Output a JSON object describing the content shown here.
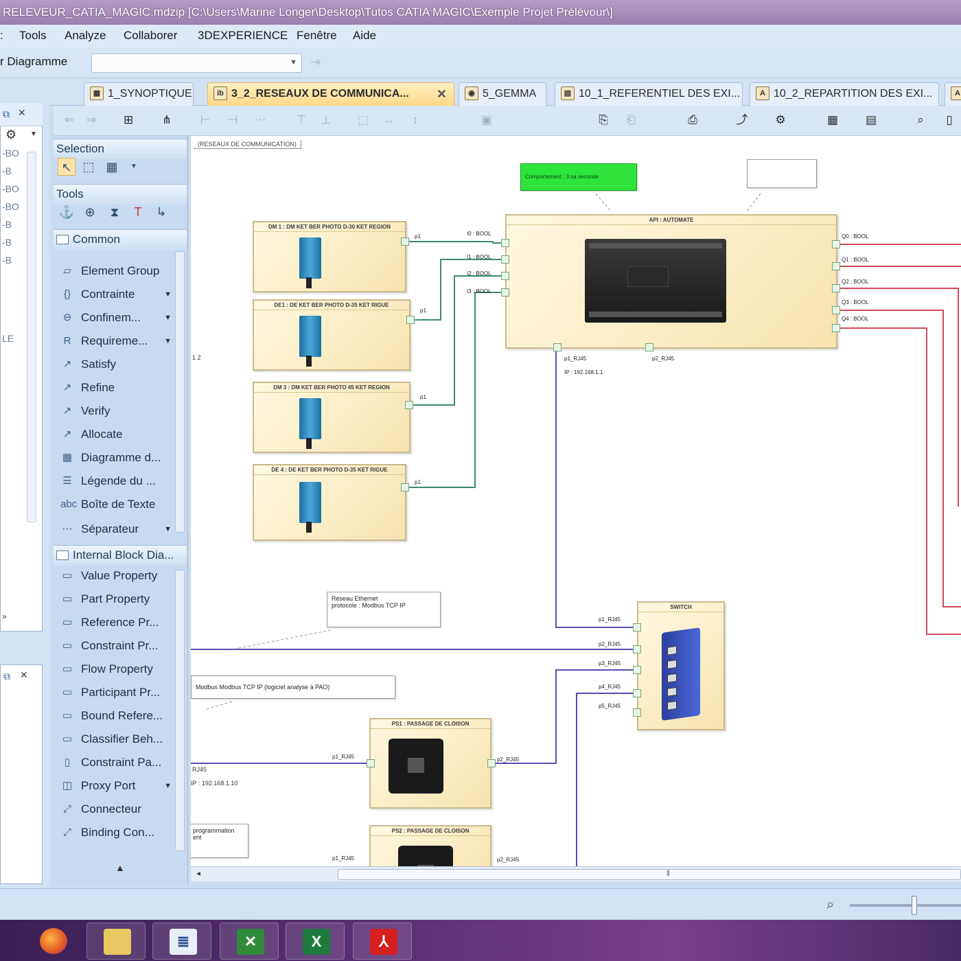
{
  "window": {
    "title": "RELEVEUR_CATIA_MAGIC.mdzip [C:\\Users\\Marine Longer\\Desktop\\Tutos CATIA MAGIC\\Exemple Projet Prélèvour\\]"
  },
  "menu": {
    "items": [
      "Tools",
      "Analyze",
      "Collaborer",
      "3DEXPERIENCE",
      "Fenêtre",
      "Aide"
    ]
  },
  "toolbar": {
    "diagram_label": "r Diagramme",
    "combo_value": ""
  },
  "left_panel": {
    "rows": [
      "-BO",
      "-B",
      "-BO",
      "-BO",
      "-B",
      "-B",
      "-B",
      "LE"
    ]
  },
  "tabs": [
    {
      "label": "1_SYNOPTIQUE",
      "active": false
    },
    {
      "label": "3_2_RESEAUX DE COMMUNICA...",
      "active": true
    },
    {
      "label": "5_GEMMA",
      "active": false
    },
    {
      "label": "10_1_REFERENTIEL DES EXI...",
      "active": false
    },
    {
      "label": "10_2_REPARTITION DES EXI...",
      "active": false
    }
  ],
  "palette": {
    "sections": {
      "selection": "Selection",
      "tools": "Tools",
      "common": "Common",
      "ibd": "Internal Block Dia..."
    },
    "common_items": [
      "Element Group",
      "Contrainte",
      "Confinem...",
      "Requireme...",
      "Satisfy",
      "Refine",
      "Verify",
      "Allocate",
      "Diagramme d...",
      "Légende du ...",
      "Boîte de Texte",
      "Séparateur"
    ],
    "ibd_items": [
      "Value Property",
      "Part Property",
      "Reference Pr...",
      "Constraint Pr...",
      "Flow Property",
      "Participant Pr...",
      "Bound Refere...",
      "Classifier Beh...",
      "Constraint Pa...",
      "Proxy Port",
      "Connecteur",
      "Binding Con..."
    ]
  },
  "diagram": {
    "frame_label": "(RESEAUX DE COMMUNICATION)",
    "blocks": {
      "d1": "DM 1 : DM KET BER PHOTO D-30 KET REGION",
      "d2": "DE1 : DE KET BER PHOTO D-35 KET RIGUE",
      "d3": "DM 3 : DM KET BER PHOTO 45 KET REGION",
      "d4": "DE 4 : DE KET BER PHOTO D-35 KET RIGUE",
      "api": "API : AUTOMATE",
      "switch": "SWITCH",
      "p1": "PS1 : PASSAGE DE CLOISON",
      "p2": "PS2 : PASSAGE DE CLOISON"
    },
    "sensor_port": "p1",
    "api_inputs": [
      "I0 : BOOL",
      "I1 : BOOL",
      "I2 : BOOL",
      "I3 : BOOL"
    ],
    "api_outputs": [
      "Q0 : BOOL",
      "Q1 : BOOL",
      "Q2 : BOOL",
      "Q3 : BOOL",
      "Q4 : BOOL"
    ],
    "api_eth": [
      "p1_RJ45",
      "p2_RJ45"
    ],
    "api_ip": "IP : 192.168.1.1",
    "switch_ports": [
      "p1_RJ45",
      "p2_RJ45",
      "p3_RJ45",
      "p4_RJ45",
      "p5_RJ45"
    ],
    "passage_ports": [
      "p1_RJ45",
      "p2_RJ45"
    ],
    "notes": {
      "green": "Comportement : 3 sa seconde",
      "ethernet_1": "Réseau Ethernet",
      "ethernet_2": "protocole : Modbus TCP IP",
      "modbus": "Modbus Modbus TCP IP (logiciel analyse à PAO)",
      "bottom_1": "programmation",
      "bottom_2": "ent"
    },
    "left_text_1": "1 2",
    "left_rj45": "RJ45",
    "left_ip": "IP : 192.168.1.10"
  },
  "colors": {
    "signal": "#3c8a6a",
    "ethernet": "#5a4bb0",
    "outputs": "#d0485a",
    "accent_tab": "#fdd98a"
  },
  "status": {
    "zoom_fraction": 0.58
  },
  "taskbar": {
    "apps": [
      "firefox-icon",
      "file-explorer-icon",
      "document-app-icon",
      "project-app-icon",
      "excel-icon",
      "acrobat-icon"
    ]
  }
}
